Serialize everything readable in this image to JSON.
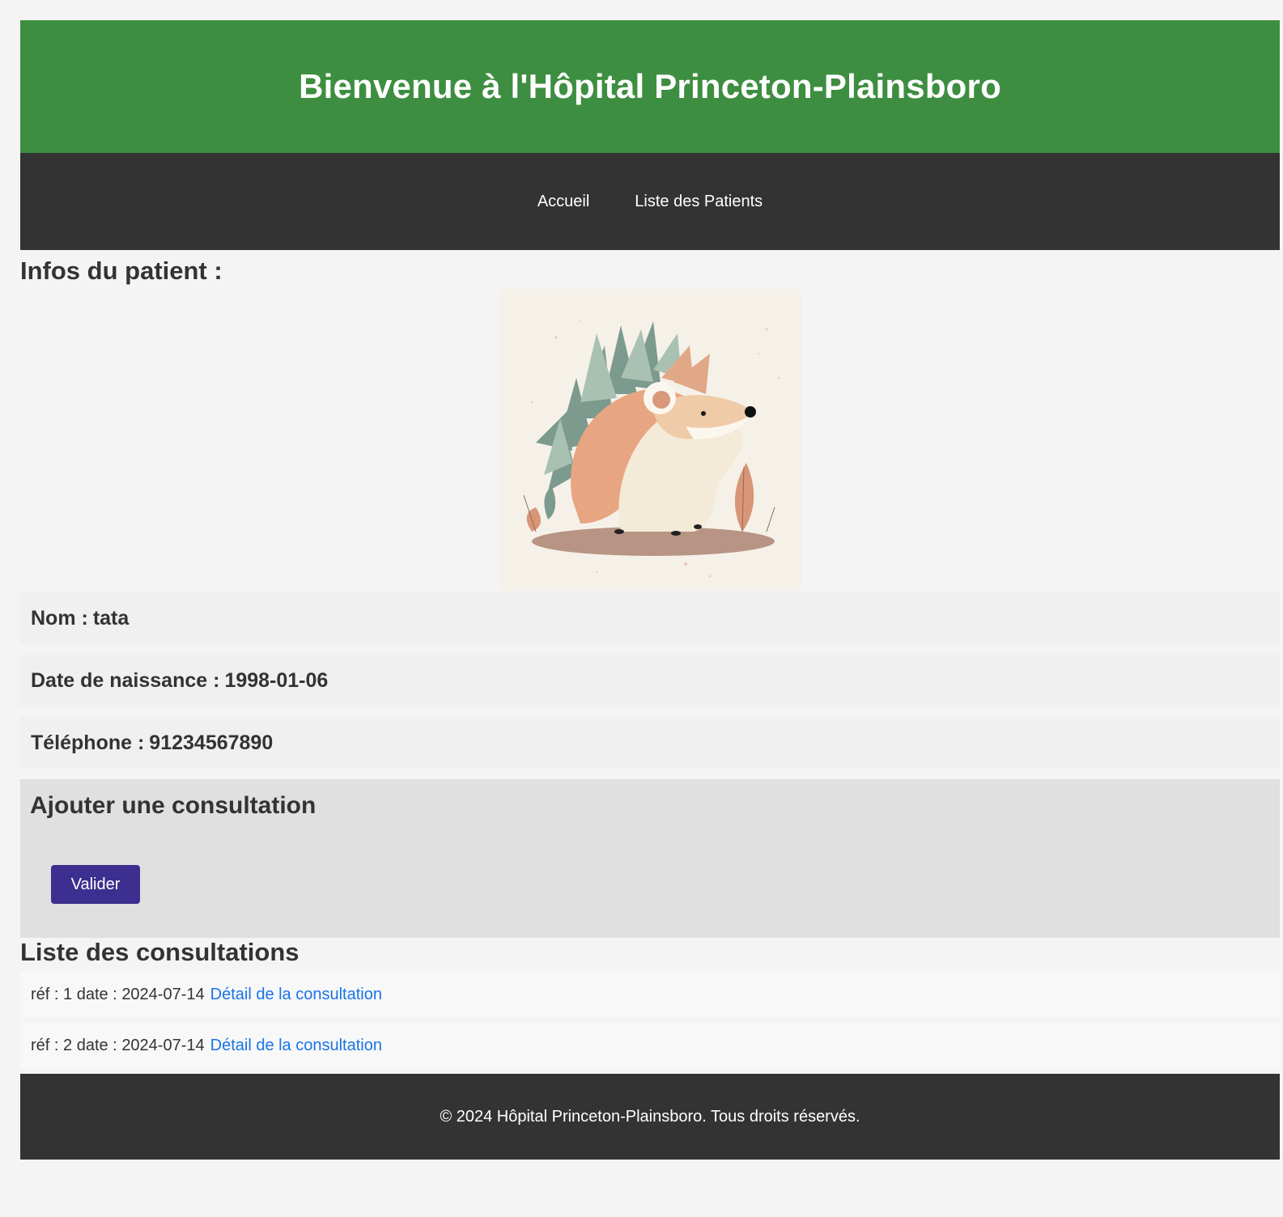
{
  "header": {
    "title": "Bienvenue à l'Hôpital Princeton-Plainsboro"
  },
  "nav": {
    "items": [
      {
        "label": "Accueil"
      },
      {
        "label": "Liste des Patients"
      }
    ]
  },
  "patient": {
    "section_title": "Infos du patient :",
    "avatar_icon": "hedgehog-illustration",
    "name_label": "Nom :",
    "name": "tata",
    "birth_label": "Date de naissance :",
    "birth_date": "1998-01-06",
    "phone_label": "Téléphone :",
    "phone": "91234567890"
  },
  "add_consultation": {
    "title": "Ajouter une consultation",
    "submit_label": "Valider"
  },
  "consultations": {
    "title": "Liste des consultations",
    "items": [
      {
        "ref_label": "réf :",
        "ref": "1",
        "date_label": "date :",
        "date": "2024-07-14",
        "link": "Détail de la consultation"
      },
      {
        "ref_label": "réf :",
        "ref": "2",
        "date_label": "date :",
        "date": "2024-07-14",
        "link": "Détail de la consultation"
      }
    ]
  },
  "footer": {
    "text": "© 2024 Hôpital Princeton-Plainsboro. Tous droits réservés."
  },
  "colors": {
    "header_bg": "#3e8e41",
    "nav_bg": "#333333",
    "button_bg": "#3c2f8f",
    "link": "#1a73e8"
  }
}
